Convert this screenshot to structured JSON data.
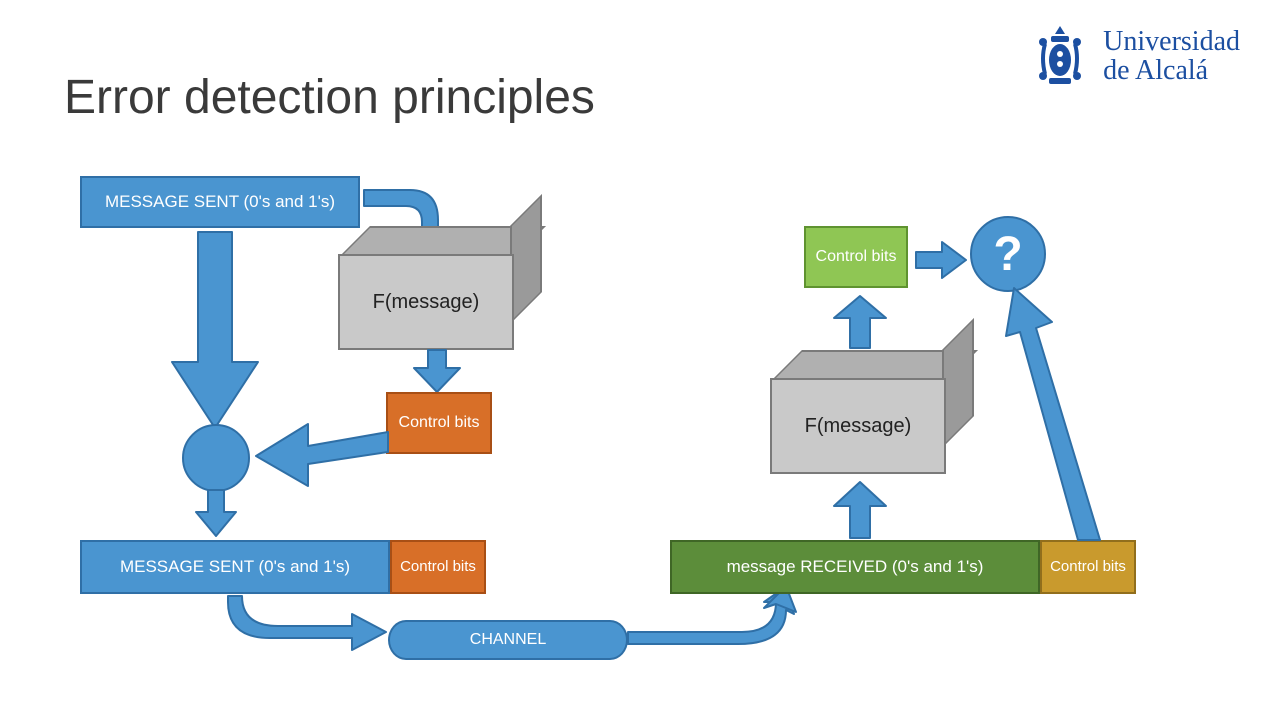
{
  "title": "Error detection principles",
  "logo": {
    "line1": "Universidad",
    "line2": "de Alcalá"
  },
  "sender": {
    "message_sent_top": "MESSAGE SENT (0's and 1's)",
    "fmessage": "F(message)",
    "control_bits": "Control bits",
    "message_sent_bottom": "MESSAGE SENT (0's and 1's)",
    "control_bits_bottom": "Control bits"
  },
  "channel": "CHANNEL",
  "receiver": {
    "message_received": "message RECEIVED (0's and 1's)",
    "control_bits_bottom": "Control bits",
    "fmessage": "F(message)",
    "control_bits_top": "Control bits",
    "question": "?"
  }
}
